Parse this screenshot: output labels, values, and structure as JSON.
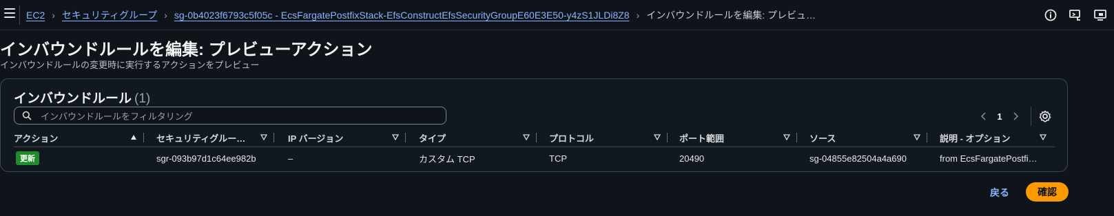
{
  "breadcrumb": {
    "items": [
      "EC2",
      "セキュリティグループ",
      "sg-0b4023f6793c5f05c - EcsFargatePostfixStack-EfsConstructEfsSecurityGroupE60E3E50-y4zS1JLDi8Z8"
    ],
    "current": "インバウンドルールを編集: プレビュ…"
  },
  "page": {
    "title": "インバウンドルールを編集: プレビューアクション",
    "description": "インバウンドルールの変更時に実行するアクションをプレビュー"
  },
  "panel": {
    "title": "インバウンドルール",
    "count": "(1)",
    "filter_placeholder": "インバウンドルールをフィルタリング",
    "page_number": "1"
  },
  "table": {
    "columns": [
      "アクション",
      "セキュリティグルー…",
      "IP バージョン",
      "タイプ",
      "プロトコル",
      "ポート範囲",
      "ソース",
      "説明 - オプション"
    ],
    "rows": [
      {
        "action": "更新",
        "sg_rule_id": "sgr-093b97d1c64ee982b",
        "ip_version": "–",
        "type": "カスタム TCP",
        "protocol": "TCP",
        "port_range": "20490",
        "source": "sg-04855e82504a4a690",
        "description": "from EcsFargatePostfi…"
      }
    ]
  },
  "footer": {
    "back_label": "戻る",
    "confirm_label": "確認"
  },
  "colors": {
    "background": "#0f141a",
    "link": "#89b4ff",
    "primary_button": "#ff9900",
    "badge_green": "#1f8b2a"
  },
  "icons": [
    "menu-icon",
    "info-icon",
    "feedback-icon",
    "screen-icon",
    "search-icon",
    "chevron-left-icon",
    "chevron-right-icon",
    "settings-icon",
    "sort-asc-icon",
    "sort-desc-icon"
  ]
}
